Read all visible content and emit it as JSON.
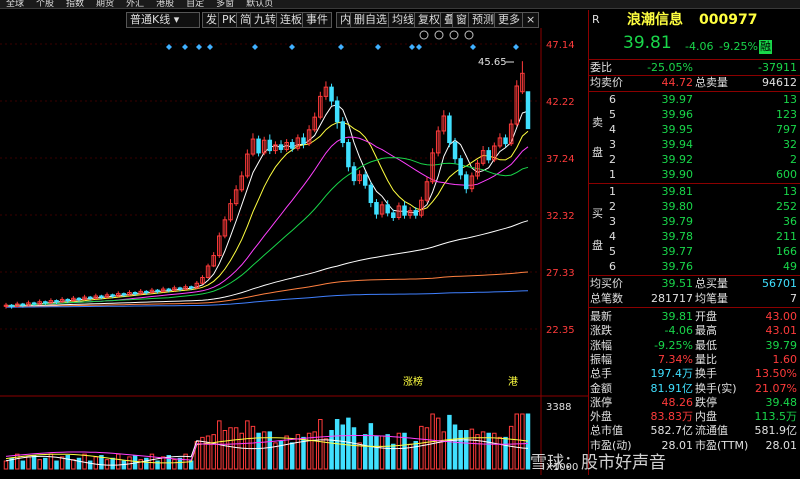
{
  "topbar": {
    "items": [
      "全球",
      "个股",
      "指数",
      "期货",
      "外汇",
      "港股",
      "自定",
      "多窗",
      "默认页"
    ]
  },
  "toolbar": {
    "period_label": "普通K线",
    "buttons": [
      "发",
      "PK",
      "简",
      "九转",
      "连板",
      "事件",
      "内",
      "删自选",
      "均线",
      "复权",
      "叠",
      "窗",
      "预测",
      "更多"
    ],
    "close": "×"
  },
  "chart": {
    "price_labels": [
      "47.14",
      "42.22",
      "37.24",
      "32.32",
      "27.33",
      "22.35"
    ],
    "peak_label": "45.65",
    "tag_left": "涨榜",
    "tag_right": "港",
    "volume_label": "3388",
    "volume_unit": "X1000",
    "colors": {
      "up": "#ff3b3b",
      "down": "#40e0ff",
      "ma1": "#ffffff",
      "ma2": "#ffff40",
      "ma3": "#ff40ff",
      "ma4": "#19d64a",
      "ma5": "#ffffff",
      "ma6": "#ff8040",
      "ma7": "#4080ff"
    }
  },
  "header": {
    "stock_name": "浪潮信息",
    "stock_code": "000977",
    "market_badge": "R",
    "price": "39.81",
    "change": "-4.06",
    "change_pct": "-9.25%",
    "tag": "融"
  },
  "orderbook": {
    "weibi_label": "委比",
    "weibi_pct": "-25.05%",
    "weibi_val": "-37911",
    "avg_sell_label": "均卖价",
    "avg_sell": "44.72",
    "total_sell_label": "总卖量",
    "total_sell": "94612",
    "sell_label_1": "卖",
    "sell_label_2": "盘",
    "sell": [
      {
        "level": "6",
        "price": "39.97",
        "vol": "13"
      },
      {
        "level": "5",
        "price": "39.96",
        "vol": "123"
      },
      {
        "level": "4",
        "price": "39.95",
        "vol": "797"
      },
      {
        "level": "3",
        "price": "39.94",
        "vol": "32"
      },
      {
        "level": "2",
        "price": "39.92",
        "vol": "2"
      },
      {
        "level": "1",
        "price": "39.90",
        "vol": "600"
      }
    ],
    "buy_label_1": "买",
    "buy_label_2": "盘",
    "buy": [
      {
        "level": "1",
        "price": "39.81",
        "vol": "13"
      },
      {
        "level": "2",
        "price": "39.80",
        "vol": "252"
      },
      {
        "level": "3",
        "price": "39.79",
        "vol": "36"
      },
      {
        "level": "4",
        "price": "39.78",
        "vol": "211"
      },
      {
        "level": "5",
        "price": "39.77",
        "vol": "166"
      },
      {
        "level": "6",
        "price": "39.76",
        "vol": "49"
      }
    ],
    "avg_buy_label": "均买价",
    "avg_buy": "39.51",
    "total_buy_label": "总买量",
    "total_buy": "56701",
    "total_orders_label": "总笔数",
    "total_orders": "281717",
    "avg_per_label": "均笔量",
    "avg_per": "7"
  },
  "stats": [
    {
      "l1": "最新",
      "v1": "39.81",
      "c1": "grn",
      "l2": "开盘",
      "v2": "43.00",
      "c2": "red"
    },
    {
      "l1": "涨跌",
      "v1": "-4.06",
      "c1": "grn",
      "l2": "最高",
      "v2": "43.01",
      "c2": "red"
    },
    {
      "l1": "涨幅",
      "v1": "-9.25%",
      "c1": "grn",
      "l2": "最低",
      "v2": "39.79",
      "c2": "grn"
    },
    {
      "l1": "振幅",
      "v1": "7.34%",
      "c1": "red",
      "l2": "量比",
      "v2": "1.60",
      "c2": "red"
    },
    {
      "l1": "总手",
      "v1": "197.4万",
      "c1": "cyan",
      "l2": "换手",
      "v2": "13.50%",
      "c2": "red"
    },
    {
      "l1": "金额",
      "v1": "81.91亿",
      "c1": "cyan",
      "l2": "换手(实)",
      "v2": "21.07%",
      "c2": "red"
    },
    {
      "l1": "涨停",
      "v1": "48.26",
      "c1": "red",
      "l2": "跌停",
      "v2": "39.48",
      "c2": "grn"
    },
    {
      "l1": "外盘",
      "v1": "83.83万",
      "c1": "red",
      "l2": "内盘",
      "v2": "113.5万",
      "c2": "grn"
    },
    {
      "l1": "总市值",
      "v1": "582.7亿",
      "c1": "wht",
      "l2": "流通值",
      "v2": "581.9亿",
      "c2": "wht"
    },
    {
      "l1": "市盈(动)",
      "v1": "28.01",
      "c1": "wht",
      "l2": "市盈(TTM)",
      "v2": "28.01",
      "c2": "wht"
    }
  ],
  "watermark": "雪球：股市好声音"
}
